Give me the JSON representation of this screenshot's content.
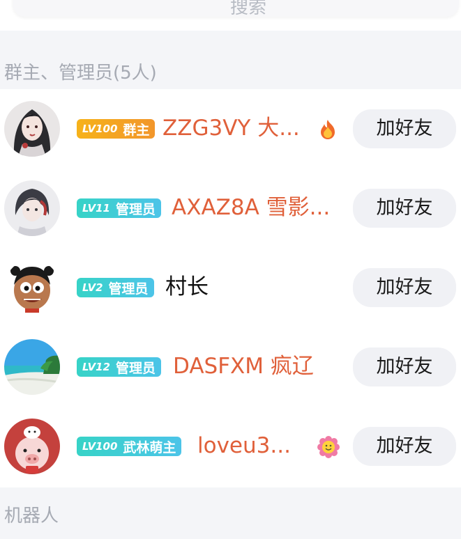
{
  "search": {
    "label": "搜索"
  },
  "sections": {
    "admins": "群主、管理员(5人)",
    "bots": "机器人"
  },
  "members": [
    {
      "level": "LV100",
      "role": "群主",
      "name": "ZZG3VY   大...",
      "name_color": "orange",
      "badge_style": "gold",
      "tag_icon": "fire-icon"
    },
    {
      "level": "LV11",
      "role": "管理员",
      "name": "AXAZ8A  雪影...",
      "name_color": "orange",
      "badge_style": "teal"
    },
    {
      "level": "LV2",
      "role": "管理员",
      "name": "村长",
      "name_color": "black",
      "badge_style": "teal"
    },
    {
      "level": "LV12",
      "role": "管理员",
      "name": "DASFXM 疯辽",
      "name_color": "orange",
      "badge_style": "teal"
    },
    {
      "level": "LV100",
      "role": "武林萌主",
      "name": "loveu3...",
      "name_color": "orange",
      "badge_style": "teal",
      "tag_icon": "smiley-flower-icon"
    }
  ],
  "add_friend_label": "加好友",
  "colors": {
    "orange_name": "#e0603a",
    "gold_badge": "#f4a823",
    "teal_badge": "#3ecfd6",
    "button_bg": "#f0f1f5",
    "section_text": "#a6aab3"
  }
}
